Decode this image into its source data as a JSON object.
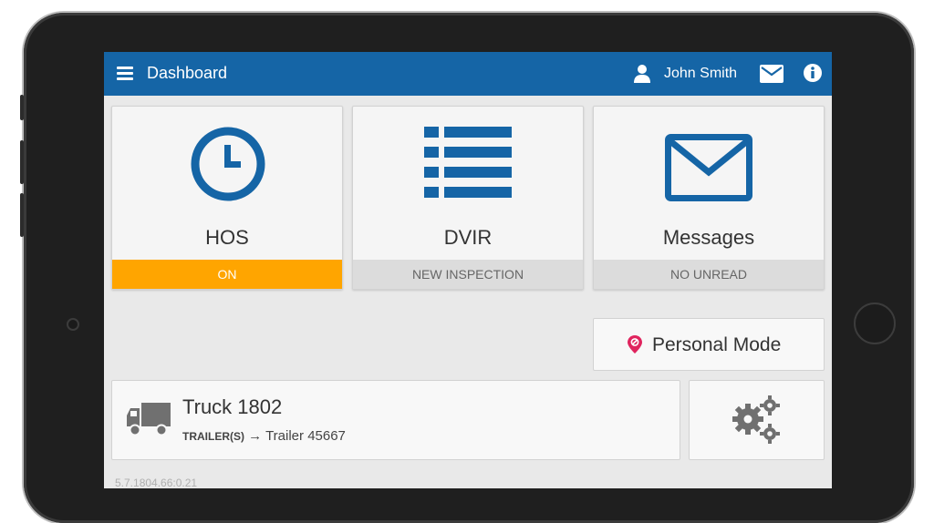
{
  "header": {
    "title": "Dashboard",
    "user_name": "John Smith",
    "bar_color": "#1565a6"
  },
  "tiles": [
    {
      "label": "HOS",
      "status": "ON",
      "icon": "clock-icon",
      "status_color": "#ffa500"
    },
    {
      "label": "DVIR",
      "status": "NEW INSPECTION",
      "icon": "list-icon"
    },
    {
      "label": "Messages",
      "status": "NO UNREAD",
      "icon": "envelope-icon"
    }
  ],
  "personal_mode": {
    "label": "Personal Mode",
    "icon": "location-pin-icon",
    "icon_color": "#e0245e"
  },
  "vehicle": {
    "truck": "Truck 1802",
    "trailer_key": "TRAILER(S)",
    "arrow": "→",
    "trailer": "Trailer 45667",
    "icon": "truck-icon"
  },
  "settings": {
    "icon": "gears-icon"
  },
  "version": "5.7.1804.66:0.21",
  "accent_color": "#1565a6"
}
